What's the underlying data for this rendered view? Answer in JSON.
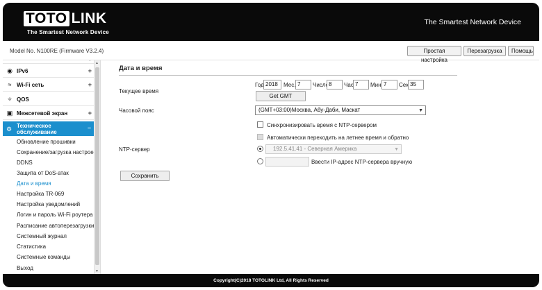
{
  "header": {
    "logo_left": "TOTO",
    "logo_right": "LINK",
    "logo_tagline": "The Smartest Network Device",
    "slogan": "The Smartest Network Device"
  },
  "modelbar": {
    "model": "Model No. N100RE (Firmware V3.2.4)",
    "buttons": [
      "Простая настройка",
      "Перезагрузка",
      "Помощь"
    ]
  },
  "sidebar": {
    "menus": [
      {
        "label": "IPv6",
        "icon": "globe-icon",
        "toggle": "+"
      },
      {
        "label": "Wi-Fi сеть",
        "icon": "wifi-icon",
        "toggle": "+"
      },
      {
        "label": "QOS",
        "icon": "qos-icon",
        "toggle": ""
      },
      {
        "label": "Межсетевой экран",
        "icon": "lock-icon",
        "toggle": "+"
      }
    ],
    "active_menu": {
      "line1": "Техническое",
      "line2": "обслуживание",
      "icon": "gear-icon",
      "toggle": "–"
    },
    "submenu": [
      "Обновление прошивки",
      "Сохранение/загрузка настроек",
      "DDNS",
      "Защита от DoS-атак",
      "Дата и время",
      "Настройка TR-069",
      "Настройка уведомлений",
      "Логин и пароль Wi-Fi роутера",
      "Расписание автоперезагрузки",
      "Системный журнал",
      "Статистика",
      "Системные команды",
      "Выход"
    ],
    "active_submenu_index": 4
  },
  "content": {
    "title": "Дата и время",
    "current_time_label": "Текущее время",
    "year_label": "Год",
    "year": "2018",
    "month_label": "Мес.",
    "month": "7",
    "day_label": "Число",
    "day": "8",
    "hour_label": "Час",
    "hour": "7",
    "minute_label": "Мин.",
    "minute": "7",
    "second_label": "Сек.",
    "second": "35",
    "get_gmt": "Get GMT",
    "timezone_label": "Часовой пояс",
    "timezone": "(GMT+03:00)Москва, Абу-Даби, Маскат",
    "ntp_sync_label": "Синхронизировать время с NTP-сервером",
    "ntp_sync_checked": false,
    "dst_label": "Автоматически переходить на летнее время и обратно",
    "dst_checked": false,
    "ntp_label": "NTP-сервер",
    "ntp_server": "192.5.41.41 - Северная Америка",
    "ntp_manual_label": "Ввести IP-адрес NTP-сервера вручную",
    "save": "Сохранить"
  },
  "footer": {
    "text": "Copyright(C)2018 TOTOLINK Ltd, All Rights Reserved"
  }
}
